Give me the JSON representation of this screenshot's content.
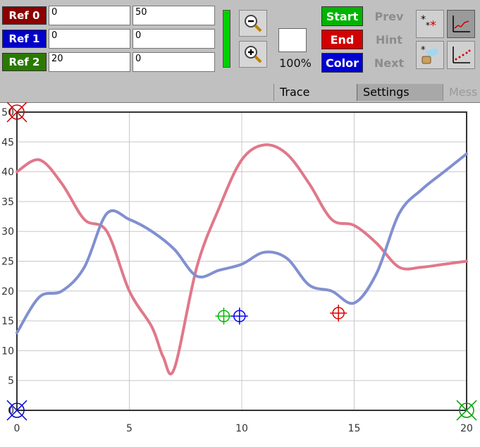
{
  "toolbar": {
    "refs": [
      {
        "label": "Ref 0",
        "x": "0",
        "y": "50",
        "color": "#8b0000"
      },
      {
        "label": "Ref 1",
        "x": "0",
        "y": "0",
        "color": "#0000c8"
      },
      {
        "label": "Ref 2",
        "x": "20",
        "y": "0",
        "color": "#2a7a00"
      }
    ],
    "zoom_percent": "100%",
    "actions": {
      "start": "Start",
      "end": "End",
      "color": "Color"
    },
    "nav": {
      "prev": "Prev",
      "hint": "Hint",
      "next": "Next"
    },
    "colors": {
      "start": "#00b400",
      "end": "#d20000",
      "color_btn": "#0000d0"
    }
  },
  "tabs": [
    {
      "label": "Trace"
    },
    {
      "label": "Settings"
    },
    {
      "label": "Mess"
    }
  ],
  "chart_data": {
    "type": "line",
    "xlim": [
      0,
      20
    ],
    "ylim": [
      0,
      50
    ],
    "x_ticks": [
      0,
      5,
      10,
      15,
      20
    ],
    "y_ticks": [
      0,
      5,
      10,
      15,
      20,
      25,
      30,
      35,
      40,
      45,
      50
    ],
    "y_tick_labels_visible": [
      "50",
      "45",
      "40",
      "35",
      "30",
      "25",
      "20",
      "15",
      "10",
      "5",
      "0"
    ],
    "grid": true,
    "series": [
      {
        "color": "#e0788a",
        "x": [
          0,
          1,
          2,
          3,
          4,
          5,
          6,
          6.5,
          7,
          8,
          9,
          10,
          11,
          12,
          13,
          14,
          15,
          16,
          17,
          18,
          19,
          20
        ],
        "y": [
          40,
          42,
          38,
          32,
          30,
          20,
          14,
          9,
          7,
          24,
          34,
          42,
          44.5,
          43,
          38,
          32,
          31,
          28,
          24,
          24,
          24.5,
          25
        ]
      },
      {
        "color": "#8090d0",
        "x": [
          0,
          1,
          2,
          3,
          4,
          5,
          6,
          7,
          8,
          9,
          10,
          11,
          12,
          13,
          14,
          15,
          16,
          17,
          18,
          19,
          20
        ],
        "y": [
          13,
          19,
          20,
          24,
          33,
          32,
          30,
          27,
          22.5,
          23.5,
          24.5,
          26.5,
          25.5,
          21,
          20,
          18,
          23,
          33,
          37,
          40,
          43
        ]
      }
    ],
    "markers": [
      {
        "x": 0,
        "y": 50,
        "color": "#cc0000",
        "style": "ref"
      },
      {
        "x": 0,
        "y": 0,
        "color": "#0000cc",
        "style": "ref"
      },
      {
        "x": 20,
        "y": 0,
        "color": "#009900",
        "style": "ref"
      },
      {
        "x": 9.2,
        "y": 15.8,
        "color": "#00bb00",
        "style": "crosshair"
      },
      {
        "x": 9.9,
        "y": 15.8,
        "color": "#0000ff",
        "style": "crosshair"
      },
      {
        "x": 14.3,
        "y": 16.3,
        "color": "#dd0000",
        "style": "crosshair"
      }
    ]
  }
}
